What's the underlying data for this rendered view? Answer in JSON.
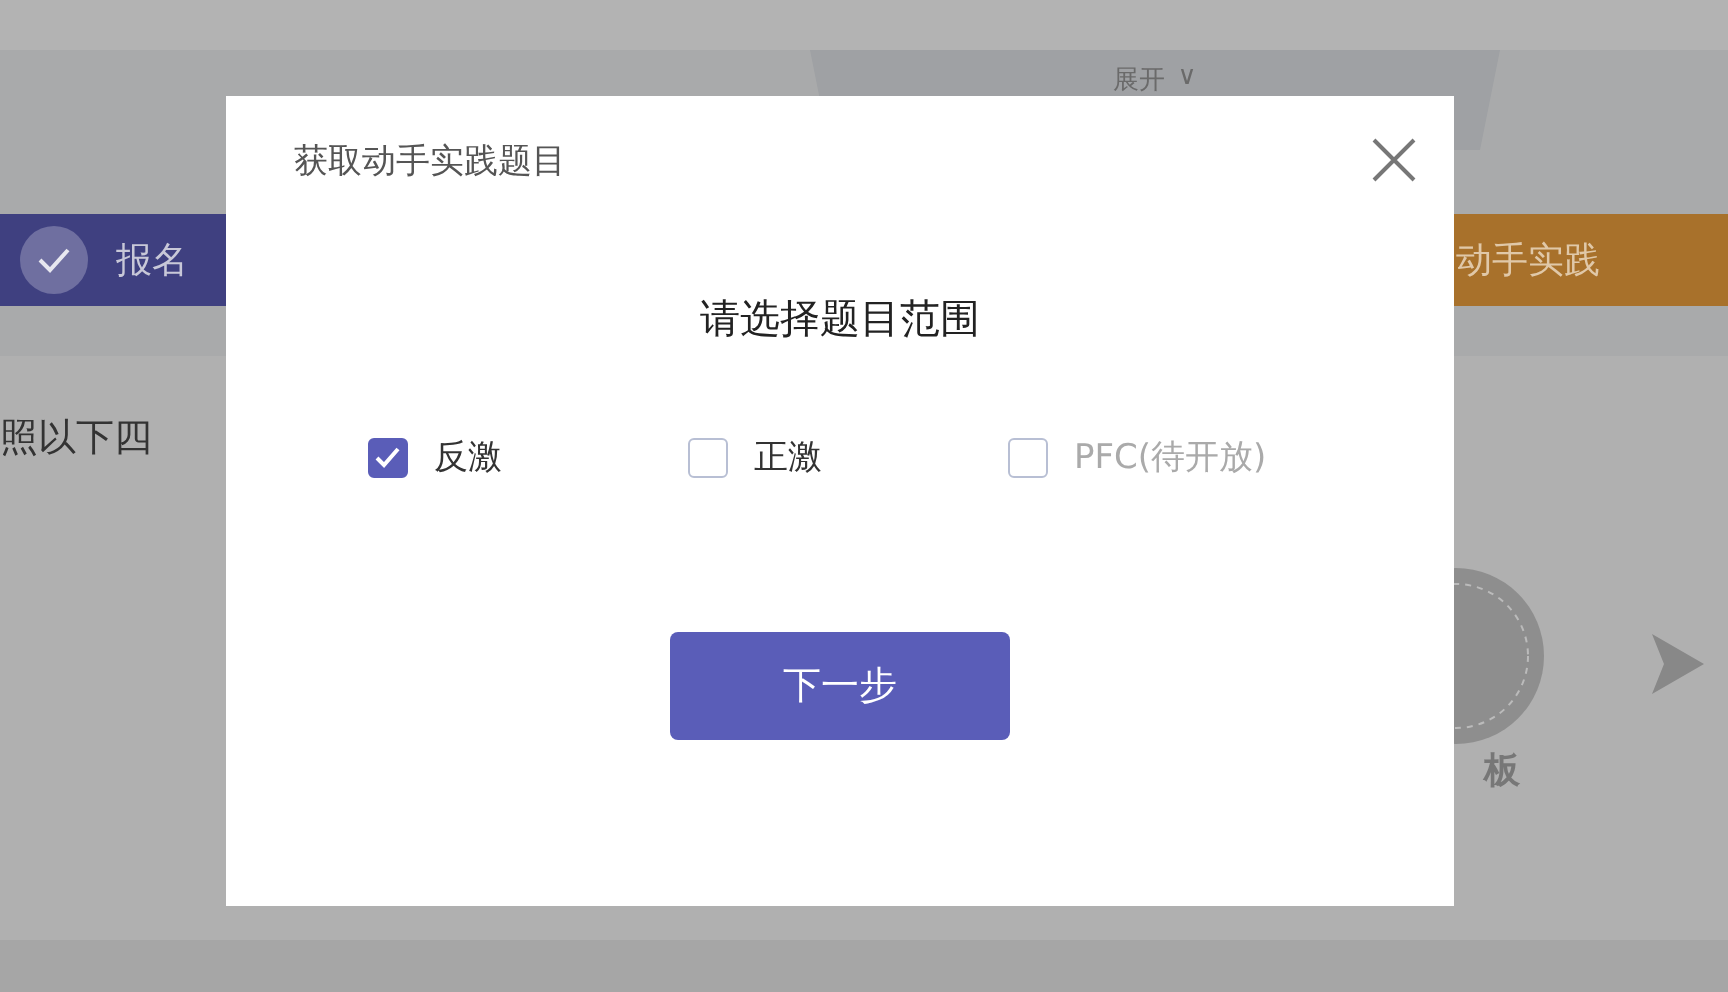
{
  "background": {
    "expand_tab": {
      "label": "展开",
      "caret": "∨"
    },
    "steps": [
      {
        "label": "报名",
        "done": true,
        "color": "#3f4080"
      },
      {
        "label": "动手实践",
        "done": false,
        "color": "#a8712b"
      }
    ],
    "intro_text": "照以下四",
    "badge_label": "板"
  },
  "dialog": {
    "title": "获取动手实践题目",
    "heading": "请选择题目范围",
    "options": [
      {
        "label": "反激",
        "checked": true,
        "disabled": false
      },
      {
        "label": "正激",
        "checked": false,
        "disabled": false
      },
      {
        "label": "PFC(待开放)",
        "checked": false,
        "disabled": true
      }
    ],
    "next_button": "下一步"
  }
}
